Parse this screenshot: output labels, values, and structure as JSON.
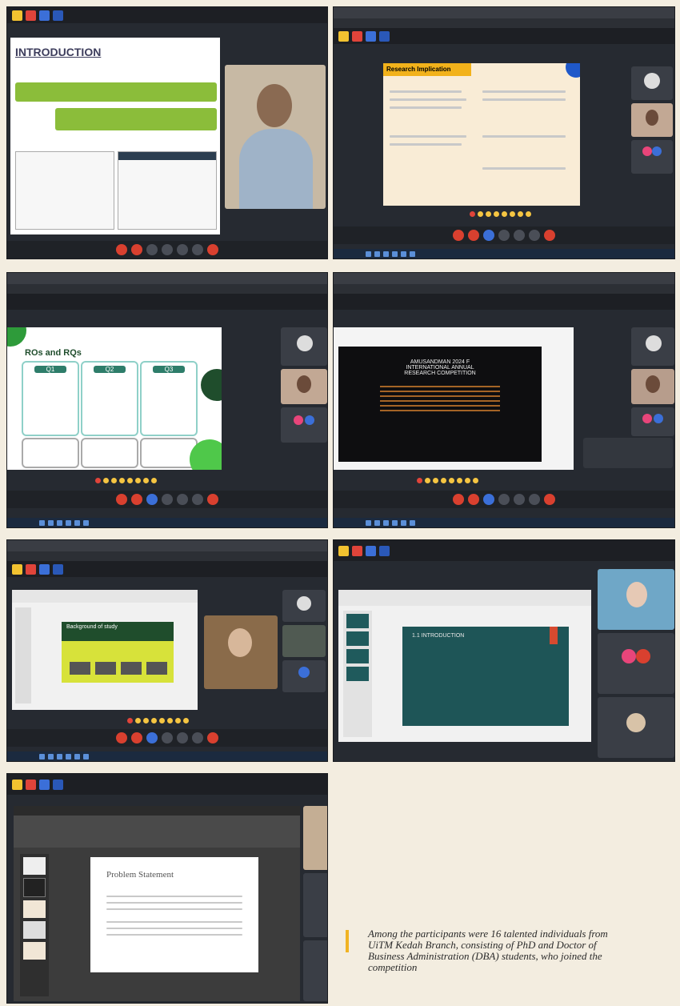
{
  "panels": [
    {
      "meeting_title": "",
      "slide_title": "INTRODUCTION"
    },
    {
      "meeting_title": "",
      "slide_title": "Research Implication"
    },
    {
      "meeting_title": "",
      "slide_title": "ROs and RQs",
      "labels": [
        "Q1",
        "Q2",
        "Q3"
      ]
    },
    {
      "meeting_title": "",
      "slide_lines": [
        "AMUSANDMAN 2024 F",
        "INTERNATIONAL ANNUAL",
        "RESEARCH COMPETITION"
      ]
    },
    {
      "meeting_title": "",
      "slide_title": "Background of study"
    },
    {
      "meeting_title": "",
      "slide_title": "1.1 INTRODUCTION"
    },
    {
      "meeting_title": "",
      "slide_title": "Problem Statement"
    }
  ],
  "caption": "Among the participants were 16 talented individuals from UiTM Kedah Branch, consisting of PhD and Doctor of Business Administration (DBA) students, who joined the competition",
  "colors": {
    "page_bg": "#f3ede0",
    "accent": "#f0b323",
    "meet_dark": "#262a31"
  }
}
